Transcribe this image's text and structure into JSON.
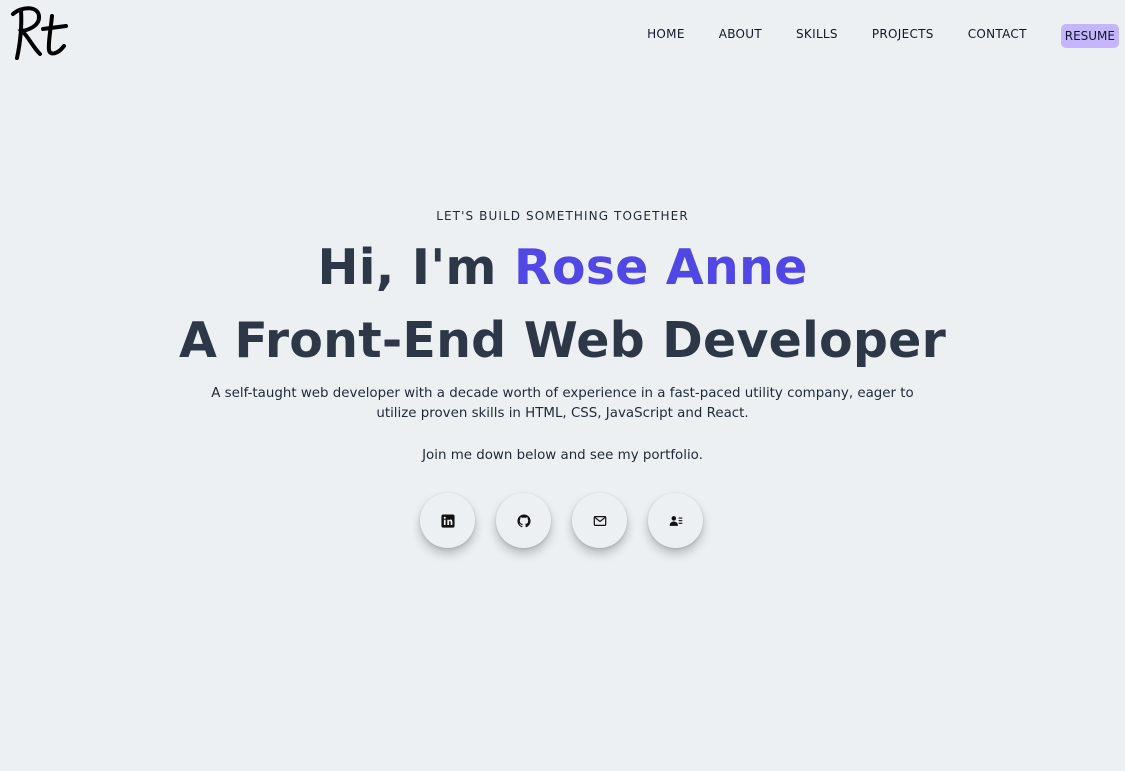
{
  "brand": {
    "logo_icon": "rt-monogram-logo"
  },
  "nav": {
    "items": [
      {
        "label": "HOME"
      },
      {
        "label": "ABOUT"
      },
      {
        "label": "SKILLS"
      },
      {
        "label": "PROJECTS"
      },
      {
        "label": "CONTACT"
      }
    ],
    "resume_label": "RESUME"
  },
  "hero": {
    "eyebrow": "LET'S BUILD SOMETHING TOGETHER",
    "greeting_prefix": "Hi, I'm ",
    "name": "Rose Anne",
    "title": "A Front-End Web Developer",
    "description": "A self-taught web developer with a decade worth of experience in a fast-paced utility company, eager to utilize proven skills in HTML, CSS, JavaScript and React.",
    "cta": "Join me down below and see my portfolio."
  },
  "social": [
    {
      "icon": "linkedin-icon"
    },
    {
      "icon": "github-icon"
    },
    {
      "icon": "mail-icon"
    },
    {
      "icon": "contact-card-icon"
    }
  ],
  "colors": {
    "background": "#ecf0f3",
    "accent": "#5047e5",
    "heading": "#2d3748",
    "resume_bg": "#c4b5fd"
  }
}
